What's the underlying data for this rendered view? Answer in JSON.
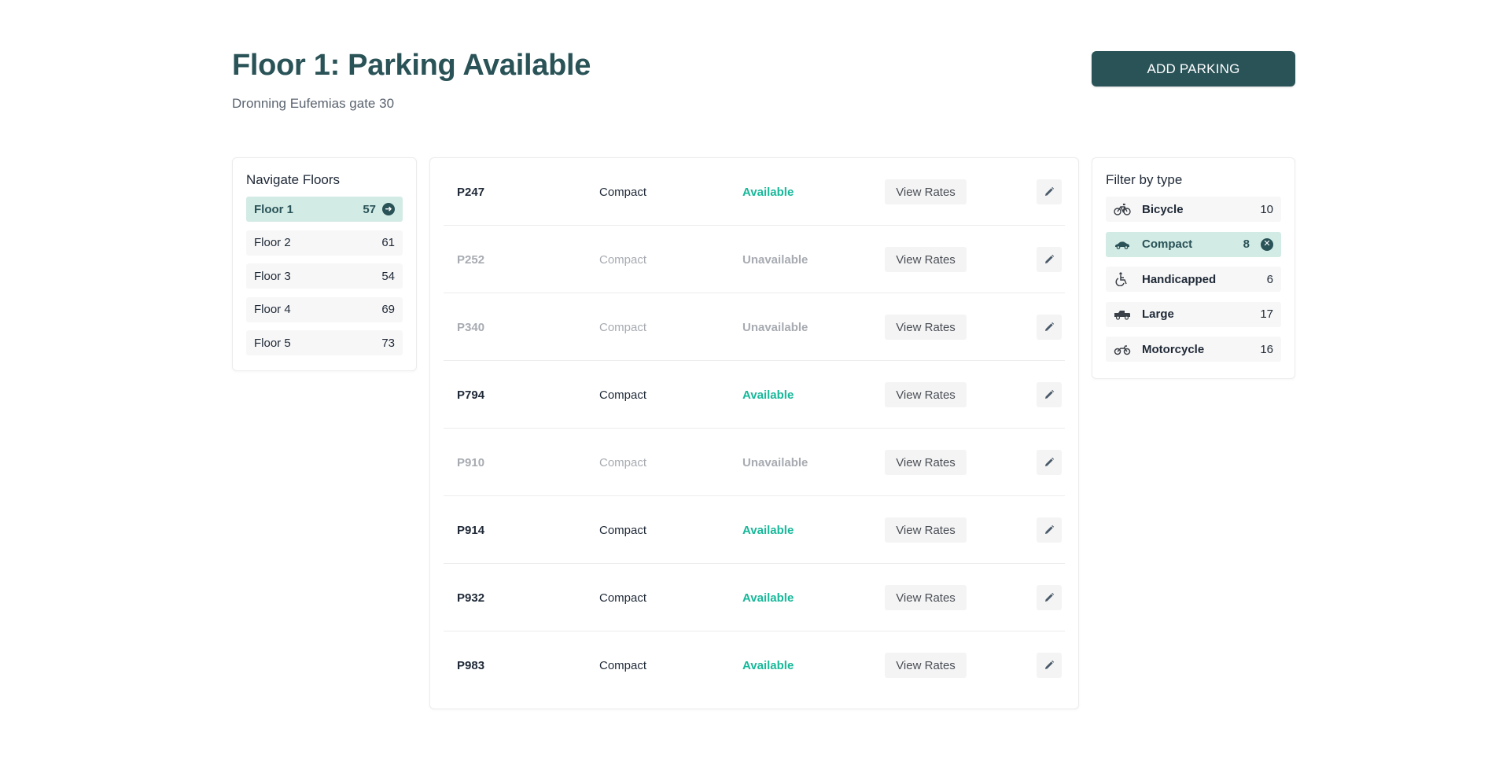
{
  "header": {
    "title": "Floor 1: Parking Available",
    "subtitle": "Dronning Eufemias gate 30",
    "add_button_label": "ADD PARKING"
  },
  "floors": {
    "heading": "Navigate Floors",
    "items": [
      {
        "label": "Floor 1",
        "count": "57",
        "active": true
      },
      {
        "label": "Floor 2",
        "count": "61",
        "active": false
      },
      {
        "label": "Floor 3",
        "count": "54",
        "active": false
      },
      {
        "label": "Floor 4",
        "count": "69",
        "active": false
      },
      {
        "label": "Floor 5",
        "count": "73",
        "active": false
      }
    ]
  },
  "parking": {
    "rates_label": "View Rates",
    "rows": [
      {
        "id": "P247",
        "type": "Compact",
        "status": "Available"
      },
      {
        "id": "P252",
        "type": "Compact",
        "status": "Unavailable"
      },
      {
        "id": "P340",
        "type": "Compact",
        "status": "Unavailable"
      },
      {
        "id": "P794",
        "type": "Compact",
        "status": "Available"
      },
      {
        "id": "P910",
        "type": "Compact",
        "status": "Unavailable"
      },
      {
        "id": "P914",
        "type": "Compact",
        "status": "Available"
      },
      {
        "id": "P932",
        "type": "Compact",
        "status": "Available"
      },
      {
        "id": "P983",
        "type": "Compact",
        "status": "Available"
      }
    ]
  },
  "filters": {
    "heading": "Filter by type",
    "items": [
      {
        "label": "Bicycle",
        "count": "10",
        "icon": "bicycle-icon",
        "active": false
      },
      {
        "label": "Compact",
        "count": "8",
        "icon": "car-icon",
        "active": true
      },
      {
        "label": "Handicapped",
        "count": "6",
        "icon": "wheelchair-icon",
        "active": false
      },
      {
        "label": "Large",
        "count": "17",
        "icon": "truck-icon",
        "active": false
      },
      {
        "label": "Motorcycle",
        "count": "16",
        "icon": "motorcycle-icon",
        "active": false
      }
    ]
  },
  "colors": {
    "primary": "#2a5358",
    "active_bg": "#d3ebe5",
    "available": "#17b89a",
    "muted": "#a7abb1"
  }
}
